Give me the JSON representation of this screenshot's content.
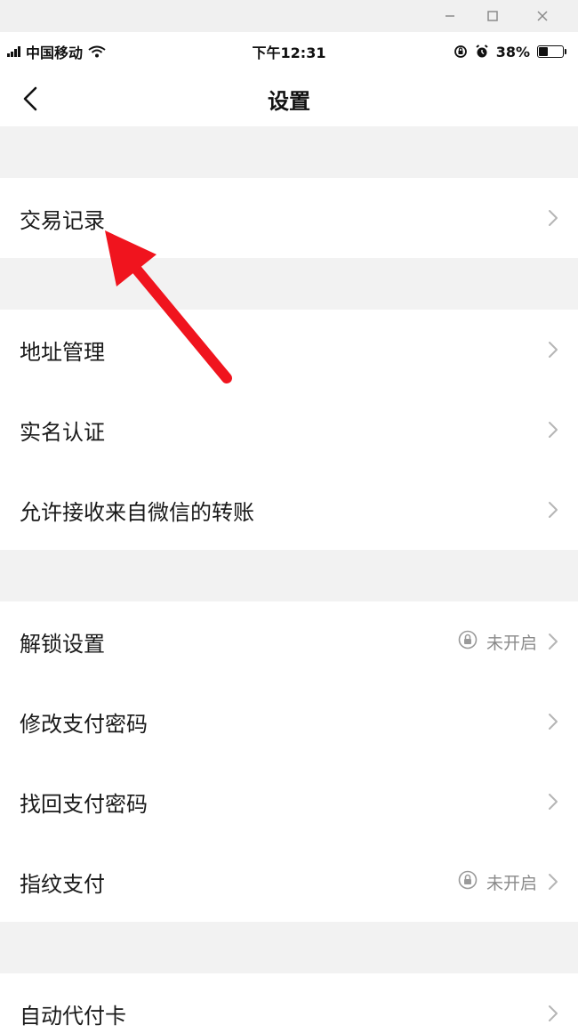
{
  "status_bar": {
    "carrier": "中国移动",
    "time": "下午12:31",
    "battery": "38%",
    "battery_level": 0.38
  },
  "header": {
    "title": "设置"
  },
  "groups": [
    {
      "rows": [
        {
          "label": "交易记录"
        }
      ]
    },
    {
      "rows": [
        {
          "label": "地址管理"
        },
        {
          "label": "实名认证"
        },
        {
          "label": "允许接收来自微信的转账"
        }
      ]
    },
    {
      "rows": [
        {
          "label": "解锁设置",
          "status": "未开启"
        },
        {
          "label": "修改支付密码"
        },
        {
          "label": "找回支付密码"
        },
        {
          "label": "指纹支付",
          "status": "未开启"
        }
      ]
    },
    {
      "rows": [
        {
          "label": "自动代付卡"
        }
      ]
    }
  ],
  "icons": {
    "back": "chevron-left-icon",
    "row_chevron": "chevron-right-icon",
    "status_lock": "lock-icon",
    "annotation": "red-arrow-annotation"
  },
  "colors": {
    "page_bg": "#ffffff",
    "section_gap": "#f2f2f2",
    "annotation_arrow": "#f0141e",
    "muted_text": "#8a8a8a"
  }
}
